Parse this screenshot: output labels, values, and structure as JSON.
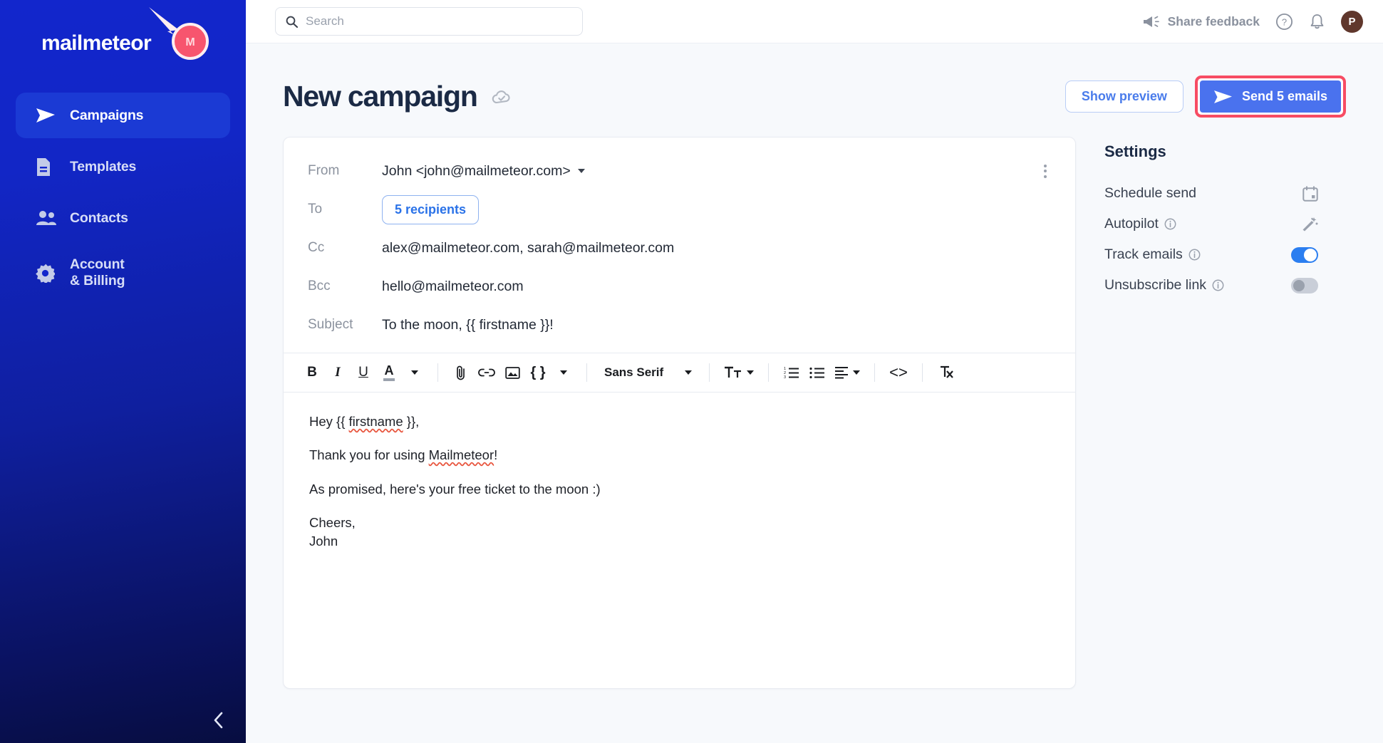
{
  "brand": {
    "name": "mailmeteor",
    "logo_icon": "comet-icon",
    "sidebar_gradient_top": "#1226cc",
    "sidebar_gradient_bottom": "#070d40",
    "accent_blue": "#4a72ee",
    "highlight_red": "#f74c63"
  },
  "sidebar": {
    "items": [
      {
        "label": "Campaigns",
        "icon": "send-icon",
        "active": true
      },
      {
        "label": "Templates",
        "icon": "document-icon",
        "active": false
      },
      {
        "label": "Contacts",
        "icon": "people-icon",
        "active": false
      },
      {
        "label": "Account",
        "label2": "& Billing",
        "icon": "gear-icon",
        "active": false
      }
    ],
    "collapse_icon": "chevron-left-icon"
  },
  "topbar": {
    "search": {
      "placeholder": "Search",
      "value": "",
      "icon": "search-icon"
    },
    "feedback_label": "Share feedback",
    "feedback_icon": "megaphone-icon",
    "help_icon": "question-circle-icon",
    "notifications_icon": "bell-icon",
    "avatar_initial": "P",
    "avatar_color": "#60372c"
  },
  "page": {
    "title": "New campaign",
    "saved_icon": "cloud-check-icon",
    "show_preview_label": "Show preview",
    "send_label": "Send 5 emails",
    "send_icon": "send-icon"
  },
  "compose": {
    "fields": [
      {
        "label": "From",
        "value": "John <john@mailmeteor.com>",
        "type": "dropdown"
      },
      {
        "label": "To",
        "value": "5 recipients",
        "type": "chip"
      },
      {
        "label": "Cc",
        "value": "alex@mailmeteor.com, sarah@mailmeteor.com",
        "type": "text"
      },
      {
        "label": "Bcc",
        "value": "hello@mailmeteor.com",
        "type": "text"
      },
      {
        "label": "Subject",
        "value": "To the moon, {{ firstname }}!",
        "type": "text"
      }
    ],
    "more_options_icon": "vertical-dots-icon",
    "toolbar": {
      "bold": "B",
      "italic": "I",
      "underline": "U",
      "text_color": "A",
      "attach_icon": "paperclip-icon",
      "link_icon": "link-icon",
      "image_icon": "image-icon",
      "merge_field": "{ }",
      "font_family": "Sans Serif",
      "font_size_icon": "Tt",
      "numbered_list_icon": "numbered-list-icon",
      "bulleted_list_icon": "bulleted-list-icon",
      "align_icon": "align-left-icon",
      "code_icon": "<>",
      "clear_format_icon": "clear-formatting-icon"
    },
    "body": {
      "line1_pre": "Hey {{ ",
      "line1_spell": "firstname",
      "line1_post": " }},",
      "line2_pre": "Thank you for using ",
      "line2_spell": "Mailmeteor",
      "line2_post": "!",
      "line3": "As promised, here's your free ticket to the moon :)",
      "line4": "Cheers,",
      "line5": "John"
    }
  },
  "settings": {
    "title": "Settings",
    "rows": [
      {
        "label": "Schedule send",
        "control": "calendar-icon",
        "has_info": false
      },
      {
        "label": "Autopilot",
        "control": "magic-wand-icon",
        "has_info": true
      },
      {
        "label": "Track emails",
        "control": "toggle",
        "state": "on",
        "has_info": true
      },
      {
        "label": "Unsubscribe link",
        "control": "toggle",
        "state": "off",
        "has_info": true
      }
    ]
  }
}
